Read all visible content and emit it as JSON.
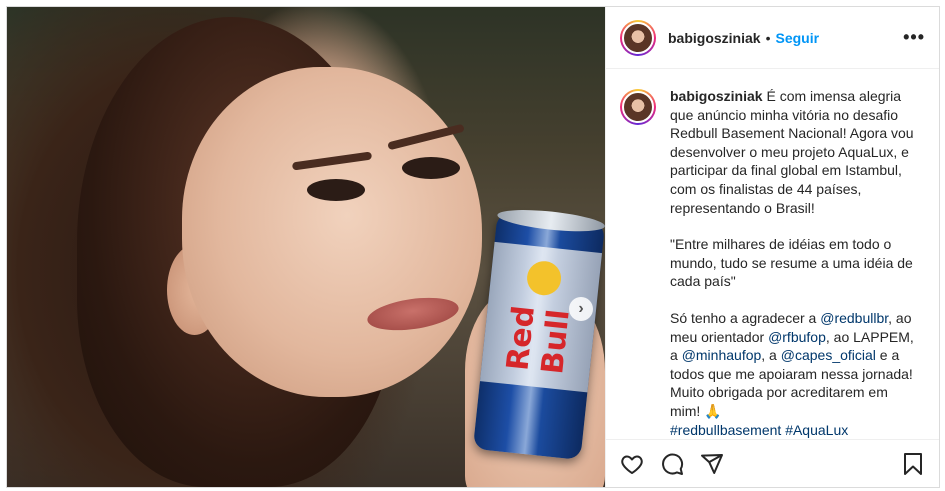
{
  "post": {
    "username": "babigosziniak",
    "separator": "•",
    "follow_label": "Seguir",
    "more_label": "•••",
    "next_label": "›",
    "can_brand": "Red Bull",
    "caption": {
      "username": "babigosziniak",
      "p1": "É com imensa alegria que anúncio minha vitória no desafio Redbull Basement Nacional! Agora vou desenvolver o meu projeto AquaLux, e participar da final global em Istambul, com os finalistas de 44 países, representando o Brasil!",
      "p2": "\"Entre milhares de idéias em todo o mundo, tudo se resume a uma idéia de cada país\"",
      "p3_a": "Só tenho a agradecer a ",
      "mention_redbullbr": "@redbullbr",
      "p3_b": ", ao meu orientador ",
      "mention_rfbufop": "@rfbufop",
      "p3_c": ", ao LAPPEM, a ",
      "mention_minhaufop": "@minhaufop",
      "p3_d": ", a ",
      "mention_capes": "@capes_oficial",
      "p3_e": " e a todos que me apoiaram nessa jornada!",
      "p4": "Muito obrigada por acreditarem em mim! 🙏",
      "hashtag1": "#redbullbasement",
      "hashtag2": "#AquaLux"
    }
  },
  "colors": {
    "accent": "#0095f6",
    "link": "#00376b",
    "text": "#262626",
    "border": "#dbdbdb"
  },
  "icons": [
    "heart-icon",
    "comment-icon",
    "share-icon",
    "bookmark-icon",
    "chevron-right-icon",
    "more-icon"
  ]
}
